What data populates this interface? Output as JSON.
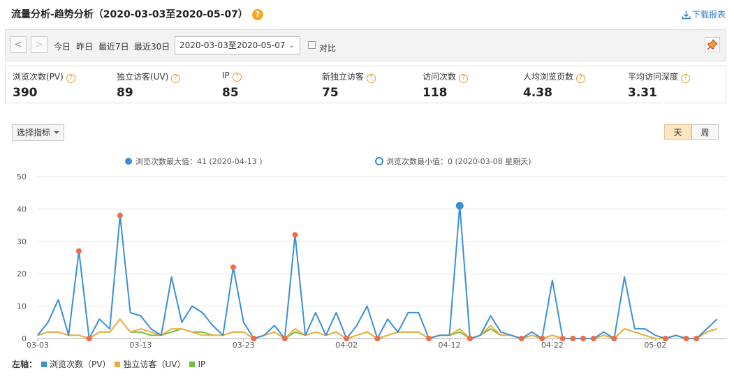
{
  "header": {
    "title": "流量分析-趋势分析（2020-03-03至2020-05-07）",
    "help": "?",
    "download_label": "下载报表"
  },
  "toolbar": {
    "prev": "<",
    "next": ">",
    "quick": [
      "今日",
      "昨日",
      "最近7日",
      "最近30日"
    ],
    "date_range": "2020-03-03至2020-05-07",
    "compare_label": "对比"
  },
  "metrics": [
    {
      "label": "浏览次数(PV)",
      "value": "390"
    },
    {
      "label": "独立访客(UV)",
      "value": "89"
    },
    {
      "label": "IP",
      "value": "85"
    },
    {
      "label": "新独立访客",
      "value": "75"
    },
    {
      "label": "访问次数",
      "value": "118"
    },
    {
      "label": "人均浏览页数",
      "value": "4.38"
    },
    {
      "label": "平均访问深度",
      "value": "3.31"
    }
  ],
  "controls": {
    "select_metric": "选择指标",
    "day": "天",
    "week": "周"
  },
  "colors": {
    "pv": "#3a8fd6",
    "uv": "#f0ad3c",
    "ip": "#6fbe3a",
    "peak": "#ef6b4b"
  },
  "chart_data": {
    "type": "line",
    "max_label": "浏览次数最大值：41 (2020-04-13 )",
    "min_label": "浏览次数最小值：0 (2020-03-08 星期天)",
    "ylim": [
      0,
      50
    ],
    "yticks": [
      0,
      10,
      20,
      30,
      40,
      50
    ],
    "x_tick_labels": [
      "03-03",
      "03-13",
      "03-23",
      "04-02",
      "04-12",
      "04-22",
      "05-02"
    ],
    "x": [
      "03-03",
      "03-04",
      "03-05",
      "03-06",
      "03-07",
      "03-08",
      "03-09",
      "03-10",
      "03-11",
      "03-12",
      "03-13",
      "03-14",
      "03-15",
      "03-16",
      "03-17",
      "03-18",
      "03-19",
      "03-20",
      "03-21",
      "03-22",
      "03-23",
      "03-24",
      "03-25",
      "03-26",
      "03-27",
      "03-28",
      "03-29",
      "03-30",
      "03-31",
      "04-01",
      "04-02",
      "04-03",
      "04-04",
      "04-05",
      "04-06",
      "04-07",
      "04-08",
      "04-09",
      "04-10",
      "04-11",
      "04-12",
      "04-13",
      "04-14",
      "04-15",
      "04-16",
      "04-17",
      "04-18",
      "04-19",
      "04-20",
      "04-21",
      "04-22",
      "04-23",
      "04-24",
      "04-25",
      "04-26",
      "04-27",
      "04-28",
      "04-29",
      "04-30",
      "05-01",
      "05-02",
      "05-03",
      "05-04",
      "05-05",
      "05-06",
      "05-07"
    ],
    "axis_legend_prefix": "左轴：",
    "series": [
      {
        "name": "浏览次数（PV）",
        "values": [
          1,
          5,
          12,
          1,
          27,
          0,
          6,
          3,
          38,
          8,
          7,
          3,
          1,
          19,
          5,
          10,
          8,
          4,
          1,
          22,
          5,
          0,
          1,
          4,
          0,
          32,
          1,
          8,
          1,
          8,
          0,
          4,
          10,
          0,
          6,
          2,
          8,
          8,
          0,
          1,
          1,
          41,
          0,
          1,
          7,
          2,
          1,
          0,
          2,
          0,
          18,
          0,
          0,
          0,
          0,
          2,
          0,
          19,
          3,
          3,
          1,
          0,
          1,
          0,
          0,
          3,
          6
        ]
      },
      {
        "name": "独立访客（UV）",
        "values": [
          1,
          2,
          2,
          1,
          1,
          0,
          2,
          2,
          6,
          2,
          3,
          2,
          1,
          3,
          3,
          2,
          1,
          1,
          1,
          2,
          2,
          0,
          1,
          2,
          0,
          3,
          1,
          2,
          1,
          2,
          0,
          1,
          2,
          0,
          1,
          2,
          2,
          2,
          0,
          1,
          1,
          3,
          0,
          1,
          4,
          1,
          1,
          0,
          1,
          0,
          1,
          0,
          0,
          0,
          0,
          1,
          0,
          3,
          2,
          1,
          0,
          0,
          1,
          0,
          0,
          2,
          3
        ]
      },
      {
        "name": "IP",
        "values": [
          1,
          2,
          2,
          1,
          1,
          0,
          2,
          2,
          6,
          2,
          2,
          1,
          1,
          2,
          3,
          2,
          2,
          1,
          1,
          2,
          2,
          0,
          1,
          2,
          0,
          2,
          1,
          2,
          1,
          2,
          0,
          1,
          2,
          0,
          1,
          2,
          2,
          2,
          0,
          1,
          1,
          2,
          0,
          1,
          3,
          1,
          1,
          0,
          1,
          0,
          1,
          0,
          0,
          0,
          0,
          1,
          0,
          3,
          2,
          1,
          0,
          0,
          1,
          0,
          0,
          2,
          3
        ]
      }
    ]
  }
}
